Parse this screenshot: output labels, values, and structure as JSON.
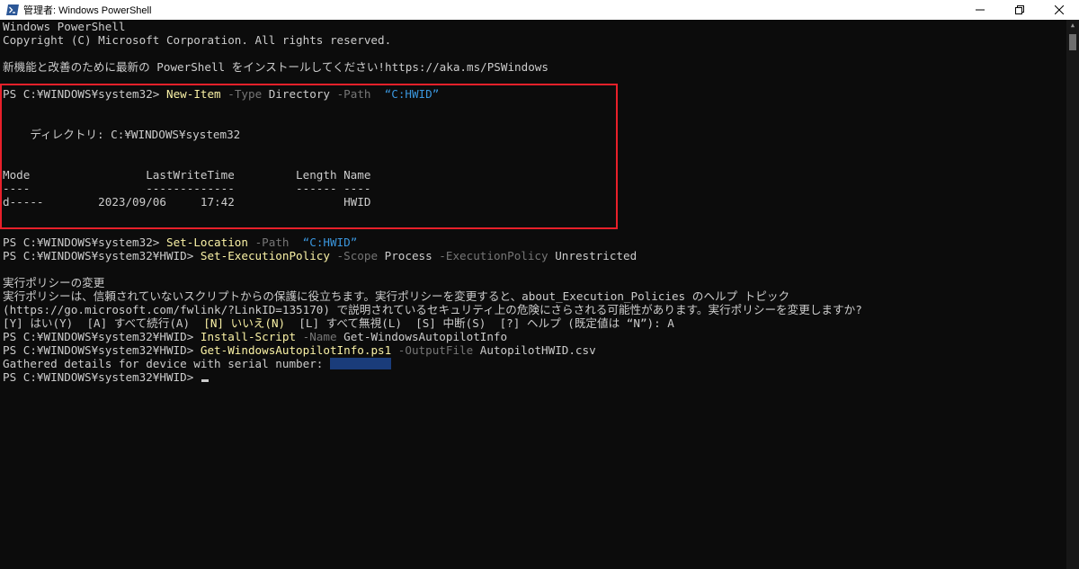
{
  "window": {
    "title": "管理者: Windows PowerShell"
  },
  "console": {
    "header1": "Windows PowerShell",
    "header2": "Copyright (C) Microsoft Corporation. All rights reserved.",
    "header3": "新機能と改善のために最新の PowerShell をインストールしてください!https://aka.ms/PSWindows",
    "cmd1": {
      "prompt": "PS C:¥WINDOWS¥system32> ",
      "cmdlet": "New-Item",
      "p1": " -Type",
      "v1": " Directory",
      "p2": " -Path",
      "v2": "  “C:HWID”"
    },
    "dir_line": "    ディレクトリ: C:¥WINDOWS¥system32",
    "table_header": "Mode                 LastWriteTime         Length Name",
    "table_sep": "----                 -------------         ------ ----",
    "table_row": "d-----        2023/09/06     17:42                HWID",
    "cmd2": {
      "prompt": "PS C:¥WINDOWS¥system32> ",
      "cmdlet": "Set-Location",
      "p1": " -Path",
      "v1": "  “C:HWID”"
    },
    "cmd3": {
      "prompt": "PS C:¥WINDOWS¥system32¥HWID> ",
      "cmdlet": "Set-ExecutionPolicy",
      "p1": " -Scope",
      "v1": " Process",
      "p2": " -ExecutionPolicy",
      "v2": " Unrestricted"
    },
    "policy_title": "実行ポリシーの変更",
    "policy_desc1": "実行ポリシーは、信頼されていないスクリプトからの保護に役立ちます。実行ポリシーを変更すると、about_Execution_Policies のヘルプ トピック",
    "policy_desc2": "(https://go.microsoft.com/fwlink/?LinkID=135170) で説明されているセキュリティ上の危険にさらされる可能性があります。実行ポリシーを変更しますか?",
    "choices": {
      "yes": "[Y] はい(Y)  ",
      "all_yes": "[A] すべて続行(A)  ",
      "no": "[N] いいえ(N)",
      "all_no": "  [L] すべて無視(L)  ",
      "suspend": "[S] 中断(S)  ",
      "help": "[?] ヘルプ (既定値は “N”): ",
      "answer": "A"
    },
    "cmd4": {
      "prompt": "PS C:¥WINDOWS¥system32¥HWID> ",
      "cmdlet": "Install-Script",
      "p1": " -Name",
      "v1": " Get-WindowsAutopilotInfo"
    },
    "cmd5": {
      "prompt": "PS C:¥WINDOWS¥system32¥HWID> ",
      "cmdlet": "Get-WindowsAutopilotInfo.ps1",
      "p1": " -OutputFile",
      "v1": " AutopilotHWID.csv"
    },
    "gathered": "Gathered details for device with serial number: ",
    "final_prompt": "PS C:¥WINDOWS¥system32¥HWID> "
  },
  "colors": {
    "background": "#0c0c0c",
    "text": "#cccccc",
    "cmdlet": "#f9f1a5",
    "parameter": "#767676",
    "string": "#3a96dd",
    "highlight_box": "#e8202a"
  },
  "icons": {
    "app": "powershell-icon",
    "minimize": "minimize-icon",
    "maximize": "restore-icon",
    "close": "close-icon"
  }
}
